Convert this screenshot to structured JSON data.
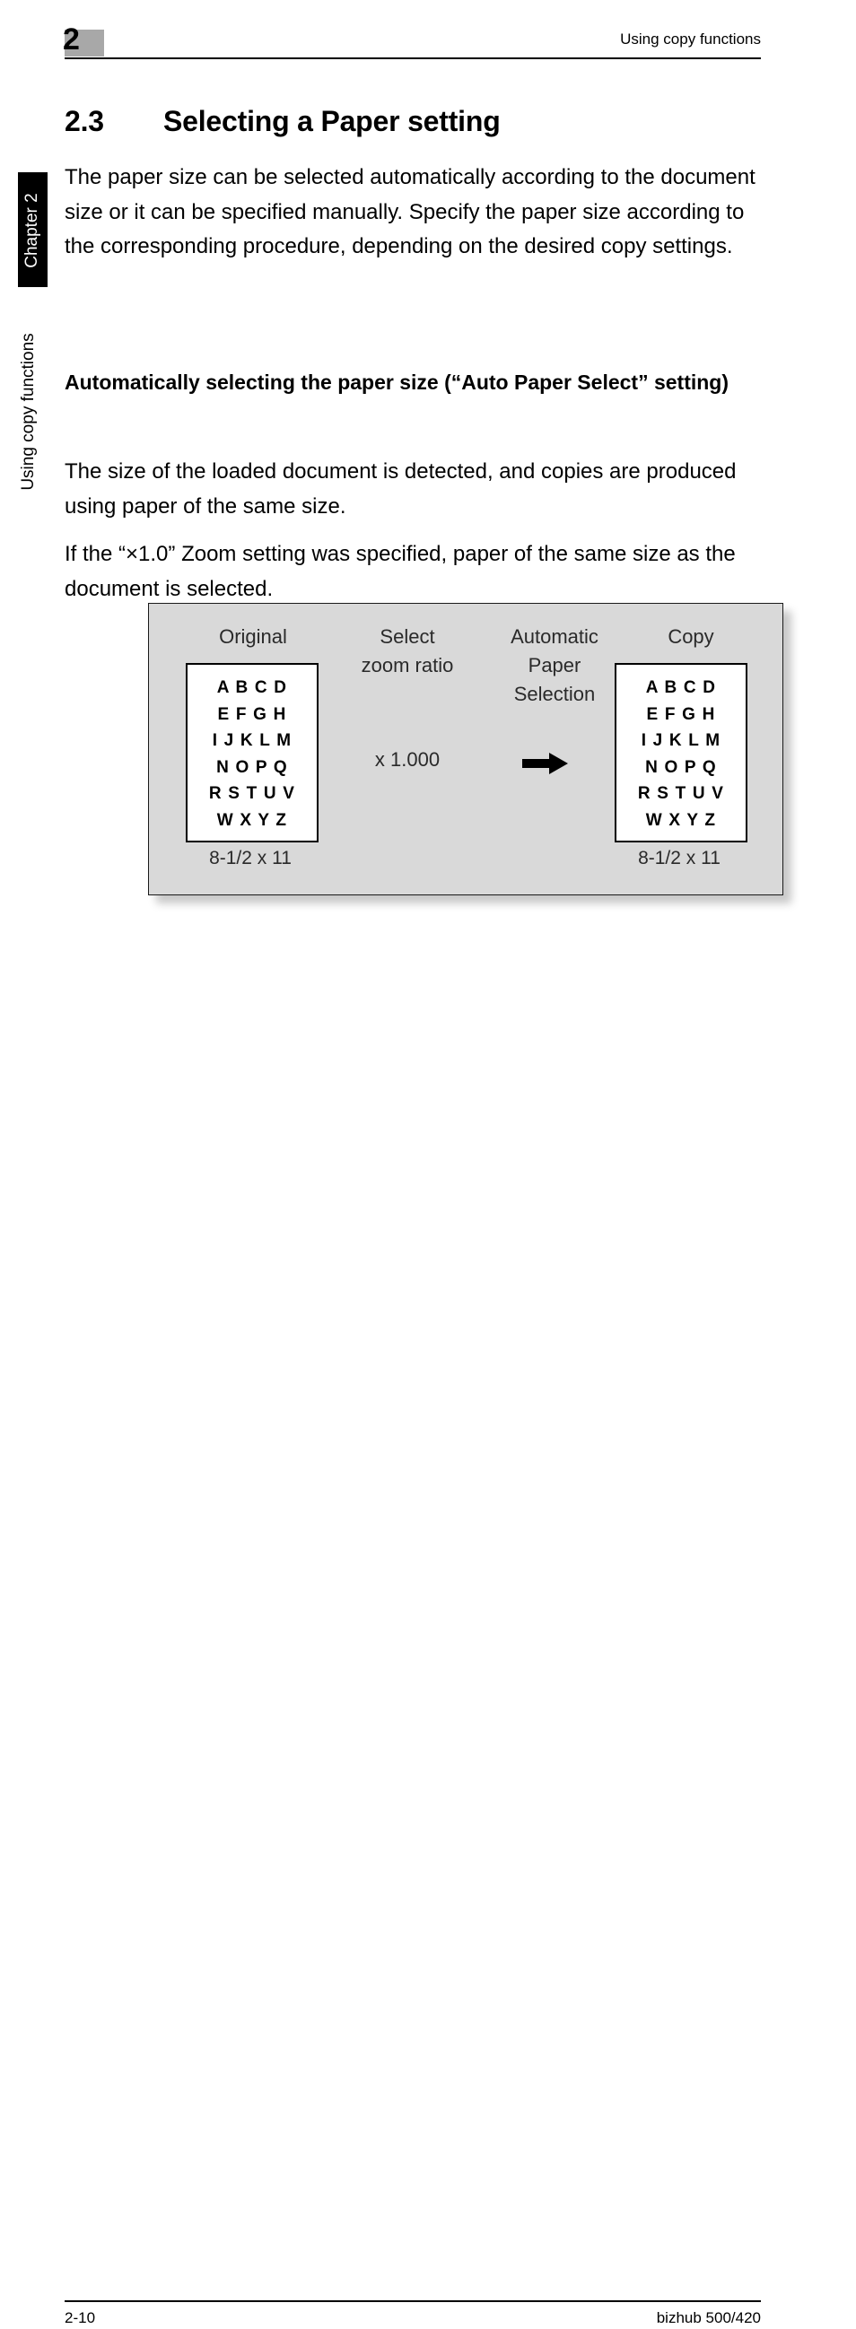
{
  "page": {
    "header": {
      "chapter_number": "2",
      "running_title": "Using copy functions"
    },
    "sidebar": {
      "chapter_tab_label": "Chapter 2",
      "running_title": "Using copy functions"
    },
    "section": {
      "number": "2.3",
      "title": "Selecting a Paper setting"
    },
    "paragraphs": {
      "intro": "The paper size can be selected automatically according to the document size or it can be specified manually. Specify the paper size according to the corresponding procedure, depending on the desired copy settings.",
      "subheading_auto_paper": "Automatically selecting the paper size (“Auto Paper Select” setting)",
      "detected": "The size of the loaded document is detected, and copies are produced using paper of the same size.",
      "zoom": "If the “×1.0” Zoom setting was specified, paper of the same size as the document is selected."
    },
    "figure": {
      "headers": {
        "original": "Original",
        "select_zoom_ratio": "Select\nzoom ratio",
        "automatic_paper_selection": "Automatic\nPaper\nSelection",
        "copy": "Copy"
      },
      "zoom_ratio_value": "x 1.000",
      "arrow_icon": "right-arrow-icon",
      "document_lines": [
        "A B C D",
        "E F G H",
        "I J K L M",
        "N O P Q",
        "R S T U V",
        "W X Y Z"
      ],
      "original_paper_size": "8-1/2 x 11",
      "copy_paper_size": "8-1/2 x 11",
      "background_color": "#d9d9d9",
      "border_color": "#1a1a1a"
    },
    "footer": {
      "page_number": "2-10",
      "product_name": "bizhub 500/420"
    },
    "colors": {
      "chapter_badge_gray": "#a8a8a8",
      "tab_black": "#000000",
      "text_black": "#000000",
      "figure_gray": "#d9d9d9"
    }
  }
}
